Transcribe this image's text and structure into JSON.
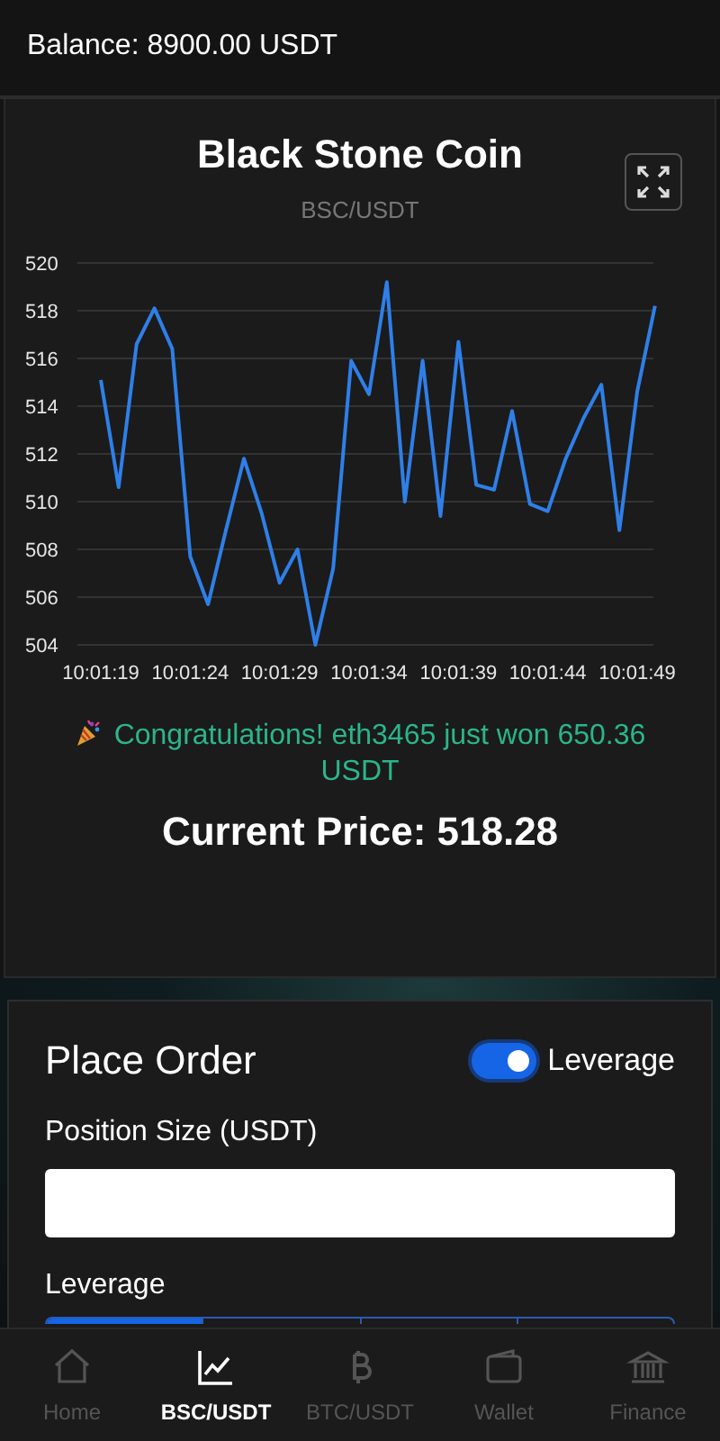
{
  "header": {
    "balance": "Balance: 8900.00 USDT"
  },
  "chart_card": {
    "title": "Black Stone Coin",
    "pair": "BSC/USDT",
    "chart_data": {
      "type": "line",
      "categories": [
        "10:01:19",
        null,
        null,
        null,
        null,
        "10:01:24",
        null,
        null,
        null,
        null,
        "10:01:29",
        null,
        null,
        null,
        null,
        "10:01:34",
        null,
        null,
        null,
        null,
        "10:01:39",
        null,
        null,
        null,
        null,
        "10:01:44",
        null,
        null,
        null,
        null,
        "10:01:49",
        null
      ],
      "series": [
        {
          "color": "#2f7fe8",
          "values": [
            515.1,
            510.6,
            516.6,
            518.1,
            516.4,
            507.7,
            505.7,
            508.8,
            511.8,
            509.5,
            506.6,
            508.0,
            504.0,
            507.2,
            515.9,
            514.5,
            519.2,
            510.0,
            515.9,
            509.4,
            516.7,
            510.7,
            510.5,
            513.8,
            509.9,
            509.6,
            511.8,
            513.5,
            514.9,
            508.8,
            514.6,
            518.2
          ]
        }
      ],
      "ylim": [
        504,
        520
      ],
      "grid": true,
      "yticks": [
        504,
        506,
        508,
        510,
        512,
        514,
        516,
        518,
        520
      ]
    },
    "notice": "Congratulations! eth3465 just won 650.36 USDT",
    "current_price": "Current Price: 518.28"
  },
  "order": {
    "title": "Place Order",
    "leverage_toggle": {
      "label": "Leverage",
      "on": true
    },
    "position_label": "Position Size (USDT)",
    "leverage_label": "Leverage",
    "leverage_options": [
      {
        "selected": true
      },
      {
        "selected": false
      },
      {
        "selected": false
      },
      {
        "selected": false
      }
    ]
  },
  "nav": [
    {
      "label": "Home",
      "selected": false,
      "kind": "home"
    },
    {
      "label": "BSC/USDT",
      "selected": true,
      "kind": "chart"
    },
    {
      "label": "BTC/USDT",
      "selected": false,
      "kind": "bitcoin"
    },
    {
      "label": "Wallet",
      "selected": false,
      "kind": "wallet"
    },
    {
      "label": "Finance",
      "selected": false,
      "kind": "bank"
    }
  ]
}
